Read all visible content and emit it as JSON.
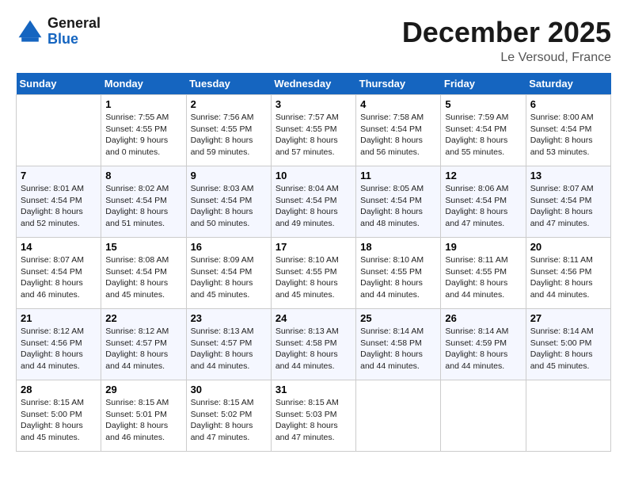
{
  "logo": {
    "line1": "General",
    "line2": "Blue"
  },
  "title": "December 2025",
  "subtitle": "Le Versoud, France",
  "weekdays": [
    "Sunday",
    "Monday",
    "Tuesday",
    "Wednesday",
    "Thursday",
    "Friday",
    "Saturday"
  ],
  "weeks": [
    [
      {
        "num": "",
        "empty": true
      },
      {
        "num": "1",
        "sunrise": "7:55 AM",
        "sunset": "4:55 PM",
        "daylight": "9 hours and 0 minutes."
      },
      {
        "num": "2",
        "sunrise": "7:56 AM",
        "sunset": "4:55 PM",
        "daylight": "8 hours and 59 minutes."
      },
      {
        "num": "3",
        "sunrise": "7:57 AM",
        "sunset": "4:55 PM",
        "daylight": "8 hours and 57 minutes."
      },
      {
        "num": "4",
        "sunrise": "7:58 AM",
        "sunset": "4:54 PM",
        "daylight": "8 hours and 56 minutes."
      },
      {
        "num": "5",
        "sunrise": "7:59 AM",
        "sunset": "4:54 PM",
        "daylight": "8 hours and 55 minutes."
      },
      {
        "num": "6",
        "sunrise": "8:00 AM",
        "sunset": "4:54 PM",
        "daylight": "8 hours and 53 minutes."
      }
    ],
    [
      {
        "num": "7",
        "sunrise": "8:01 AM",
        "sunset": "4:54 PM",
        "daylight": "8 hours and 52 minutes."
      },
      {
        "num": "8",
        "sunrise": "8:02 AM",
        "sunset": "4:54 PM",
        "daylight": "8 hours and 51 minutes."
      },
      {
        "num": "9",
        "sunrise": "8:03 AM",
        "sunset": "4:54 PM",
        "daylight": "8 hours and 50 minutes."
      },
      {
        "num": "10",
        "sunrise": "8:04 AM",
        "sunset": "4:54 PM",
        "daylight": "8 hours and 49 minutes."
      },
      {
        "num": "11",
        "sunrise": "8:05 AM",
        "sunset": "4:54 PM",
        "daylight": "8 hours and 48 minutes."
      },
      {
        "num": "12",
        "sunrise": "8:06 AM",
        "sunset": "4:54 PM",
        "daylight": "8 hours and 47 minutes."
      },
      {
        "num": "13",
        "sunrise": "8:07 AM",
        "sunset": "4:54 PM",
        "daylight": "8 hours and 47 minutes."
      }
    ],
    [
      {
        "num": "14",
        "sunrise": "8:07 AM",
        "sunset": "4:54 PM",
        "daylight": "8 hours and 46 minutes."
      },
      {
        "num": "15",
        "sunrise": "8:08 AM",
        "sunset": "4:54 PM",
        "daylight": "8 hours and 45 minutes."
      },
      {
        "num": "16",
        "sunrise": "8:09 AM",
        "sunset": "4:54 PM",
        "daylight": "8 hours and 45 minutes."
      },
      {
        "num": "17",
        "sunrise": "8:10 AM",
        "sunset": "4:55 PM",
        "daylight": "8 hours and 45 minutes."
      },
      {
        "num": "18",
        "sunrise": "8:10 AM",
        "sunset": "4:55 PM",
        "daylight": "8 hours and 44 minutes."
      },
      {
        "num": "19",
        "sunrise": "8:11 AM",
        "sunset": "4:55 PM",
        "daylight": "8 hours and 44 minutes."
      },
      {
        "num": "20",
        "sunrise": "8:11 AM",
        "sunset": "4:56 PM",
        "daylight": "8 hours and 44 minutes."
      }
    ],
    [
      {
        "num": "21",
        "sunrise": "8:12 AM",
        "sunset": "4:56 PM",
        "daylight": "8 hours and 44 minutes."
      },
      {
        "num": "22",
        "sunrise": "8:12 AM",
        "sunset": "4:57 PM",
        "daylight": "8 hours and 44 minutes."
      },
      {
        "num": "23",
        "sunrise": "8:13 AM",
        "sunset": "4:57 PM",
        "daylight": "8 hours and 44 minutes."
      },
      {
        "num": "24",
        "sunrise": "8:13 AM",
        "sunset": "4:58 PM",
        "daylight": "8 hours and 44 minutes."
      },
      {
        "num": "25",
        "sunrise": "8:14 AM",
        "sunset": "4:58 PM",
        "daylight": "8 hours and 44 minutes."
      },
      {
        "num": "26",
        "sunrise": "8:14 AM",
        "sunset": "4:59 PM",
        "daylight": "8 hours and 44 minutes."
      },
      {
        "num": "27",
        "sunrise": "8:14 AM",
        "sunset": "5:00 PM",
        "daylight": "8 hours and 45 minutes."
      }
    ],
    [
      {
        "num": "28",
        "sunrise": "8:15 AM",
        "sunset": "5:00 PM",
        "daylight": "8 hours and 45 minutes."
      },
      {
        "num": "29",
        "sunrise": "8:15 AM",
        "sunset": "5:01 PM",
        "daylight": "8 hours and 46 minutes."
      },
      {
        "num": "30",
        "sunrise": "8:15 AM",
        "sunset": "5:02 PM",
        "daylight": "8 hours and 47 minutes."
      },
      {
        "num": "31",
        "sunrise": "8:15 AM",
        "sunset": "5:03 PM",
        "daylight": "8 hours and 47 minutes."
      },
      {
        "num": "",
        "empty": true
      },
      {
        "num": "",
        "empty": true
      },
      {
        "num": "",
        "empty": true
      }
    ]
  ]
}
